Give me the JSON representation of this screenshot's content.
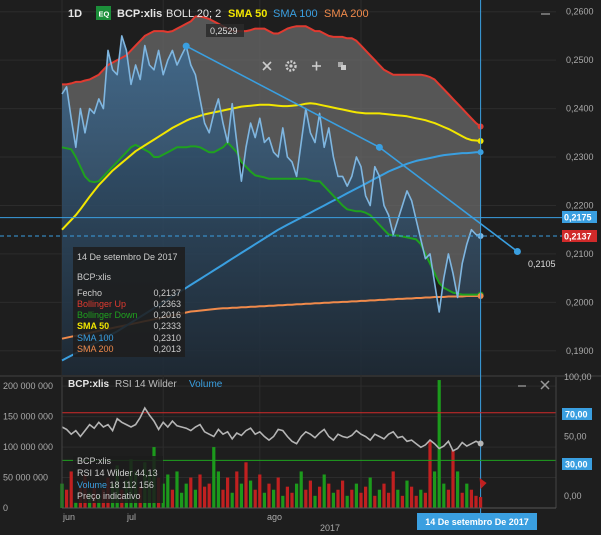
{
  "header": {
    "period": "1D",
    "badge": "EQ",
    "symbol": "BCP:xlis",
    "boll": "BOLL 20; 2",
    "sma50": "SMA 50",
    "sma100": "SMA 100",
    "sma200": "SMA 200"
  },
  "toolbar_icons": [
    "close-icon",
    "gear-icon",
    "plus-icon",
    "layers-icon"
  ],
  "colors": {
    "bg": "#1c1c1c",
    "price": "#7fb6e0",
    "boll_up": "#e03a30",
    "boll_down": "#1fa11f",
    "sma50": "#f2e600",
    "sma100": "#3a9fe0",
    "sma200": "#f08a4b",
    "crosshair": "#3a9fe0",
    "rsi": "#b5b5b5",
    "vol_up": "#1c9a1c",
    "vol_down": "#c02020"
  },
  "price_axis": {
    "ticks": [
      "0,2600",
      "0,2500",
      "0,2400",
      "0,2300",
      "0,2200",
      "0,2100",
      "0,2000",
      "0,1900"
    ],
    "badge_blue": "0,2175",
    "badge_red": "0,2137"
  },
  "annotations": {
    "peak": "0,2529",
    "trend_end": "0,2105"
  },
  "tooltip": {
    "date": "14 De setembro De 2017",
    "name": "BCP:xlis",
    "rows": [
      {
        "label": "Fecho",
        "value": "0,2137",
        "color": "#cccccc"
      },
      {
        "label": "Bollinger Up",
        "value": "0,2363",
        "color": "#e03a30"
      },
      {
        "label": "Bollinger Down",
        "value": "0,2016",
        "color": "#1fa11f"
      },
      {
        "label": "SMA 50",
        "value": "0,2333",
        "color": "#f2e600"
      },
      {
        "label": "SMA 100",
        "value": "0,2310",
        "color": "#3a9fe0"
      },
      {
        "label": "SMA 200",
        "value": "0,2013",
        "color": "#f08a4b"
      }
    ]
  },
  "lower_header": {
    "symbol": "BCP:xlis",
    "rsi": "RSI 14 Wilder",
    "volume": "Volume"
  },
  "lower_tooltip": {
    "name": "BCP:xlis",
    "rsi_label": "RSI 14 Wilder",
    "rsi_value": "44,13",
    "vol_label": "Volume",
    "vol_value": "18 112 156",
    "note": "Preço indicativo"
  },
  "vol_axis": {
    "ticks": [
      "200 000 000",
      "150 000 000",
      "100 000 000",
      "50 000 000",
      "0"
    ]
  },
  "rsi_axis": {
    "ticks": [
      "100,00",
      "70,00",
      "50,00",
      "30,00",
      "0,00"
    ],
    "badges": [
      "70,00",
      "30,00"
    ]
  },
  "x_axis": {
    "months": [
      "jun",
      "jul",
      "ago"
    ],
    "year": "2017",
    "crosshair_date": "14 De setembro De 2017"
  },
  "chart_data": {
    "type": "line",
    "price_range": [
      0.185,
      0.262
    ],
    "days": 92,
    "close": [
      0.243,
      0.2445,
      0.238,
      0.232,
      0.24,
      0.235,
      0.24,
      0.239,
      0.242,
      0.24,
      0.252,
      0.248,
      0.247,
      0.255,
      0.252,
      0.245,
      0.249,
      0.246,
      0.253,
      0.249,
      0.248,
      0.252,
      0.247,
      0.25,
      0.252,
      0.249,
      0.251,
      0.2529,
      0.249,
      0.247,
      0.242,
      0.237,
      0.235,
      0.239,
      0.242,
      0.237,
      0.233,
      0.241,
      0.233,
      0.225,
      0.232,
      0.237,
      0.234,
      0.238,
      0.233,
      0.234,
      0.231,
      0.23,
      0.236,
      0.23,
      0.229,
      0.226,
      0.233,
      0.24,
      0.235,
      0.233,
      0.239,
      0.232,
      0.236,
      0.23,
      0.226,
      0.226,
      0.224,
      0.226,
      0.23,
      0.228,
      0.222,
      0.22,
      0.228,
      0.226,
      0.22,
      0.218,
      0.214,
      0.217,
      0.22,
      0.223,
      0.221,
      0.217,
      0.213,
      0.209,
      0.21,
      0.204,
      0.198,
      0.205,
      0.21,
      0.206,
      0.201,
      0.208,
      0.212,
      0.215,
      0.214,
      0.2137
    ],
    "boll_up": [
      0.245,
      0.245,
      0.2452,
      0.2455,
      0.2455,
      0.2458,
      0.246,
      0.2465,
      0.247,
      0.248,
      0.249,
      0.2495,
      0.25,
      0.2505,
      0.251,
      0.252,
      0.253,
      0.254,
      0.255,
      0.2555,
      0.256,
      0.256,
      0.256,
      0.2558,
      0.256,
      0.2565,
      0.257,
      0.2575,
      0.258,
      0.259,
      0.259,
      0.2588,
      0.2585,
      0.258,
      0.2575,
      0.257,
      0.2565,
      0.256,
      0.256,
      0.256,
      0.256,
      0.2562,
      0.2565,
      0.2565,
      0.2565,
      0.256,
      0.2555,
      0.2555,
      0.256,
      0.2565,
      0.2568,
      0.257,
      0.257,
      0.257,
      0.2565,
      0.256,
      0.256,
      0.2555,
      0.255,
      0.2548,
      0.2548,
      0.2548,
      0.2545,
      0.2545,
      0.254,
      0.253,
      0.252,
      0.251,
      0.25,
      0.249,
      0.248,
      0.2475,
      0.247,
      0.247,
      0.247,
      0.247,
      0.247,
      0.247,
      0.247,
      0.2468,
      0.2465,
      0.246,
      0.245,
      0.244,
      0.243,
      0.242,
      0.241,
      0.24,
      0.239,
      0.238,
      0.237,
      0.2363
    ],
    "boll_down": [
      0.232,
      0.2318,
      0.2316,
      0.23,
      0.228,
      0.226,
      0.225,
      0.2248,
      0.225,
      0.226,
      0.227,
      0.228,
      0.229,
      0.23,
      0.231,
      0.232,
      0.2325,
      0.232,
      0.2315,
      0.231,
      0.23,
      0.23,
      0.2305,
      0.231,
      0.2315,
      0.232,
      0.232,
      0.232,
      0.2322,
      0.2322,
      0.232,
      0.2315,
      0.231,
      0.231,
      0.2315,
      0.232,
      0.233,
      0.232,
      0.231,
      0.229,
      0.228,
      0.227,
      0.2262,
      0.226,
      0.2258,
      0.2255,
      0.2255,
      0.2255,
      0.2255,
      0.2255,
      0.2255,
      0.2255,
      0.2255,
      0.2255,
      0.2252,
      0.225,
      0.225,
      0.224,
      0.223,
      0.222,
      0.221,
      0.22,
      0.2192,
      0.219,
      0.2188,
      0.2188,
      0.2185,
      0.218,
      0.217,
      0.216,
      0.215,
      0.214,
      0.2138,
      0.2138,
      0.2136,
      0.2134,
      0.2132,
      0.213,
      0.212,
      0.21,
      0.208,
      0.206,
      0.204,
      0.203,
      0.2025,
      0.202,
      0.2018,
      0.2016,
      0.2016,
      0.2016,
      0.2016,
      0.2016
    ],
    "sma50": [
      0.215,
      0.216,
      0.217,
      0.218,
      0.2192,
      0.2205,
      0.2218,
      0.223,
      0.2242,
      0.2252,
      0.2262,
      0.2272,
      0.228,
      0.2288,
      0.2296,
      0.2304,
      0.2312,
      0.2318,
      0.2324,
      0.233,
      0.2336,
      0.2342,
      0.2348,
      0.2354,
      0.236,
      0.2365,
      0.237,
      0.2375,
      0.2379,
      0.2382,
      0.2385,
      0.2388,
      0.239,
      0.2392,
      0.2394,
      0.2396,
      0.2398,
      0.24,
      0.2402,
      0.2404,
      0.2405,
      0.2406,
      0.2407,
      0.2408,
      0.2408,
      0.2408,
      0.2407,
      0.2406,
      0.2405,
      0.2405,
      0.2406,
      0.2407,
      0.2408,
      0.241,
      0.2411,
      0.241,
      0.2408,
      0.2406,
      0.2404,
      0.2402,
      0.24,
      0.2398,
      0.2396,
      0.2394,
      0.2392,
      0.2391,
      0.239,
      0.239,
      0.239,
      0.239,
      0.2389,
      0.2388,
      0.2387,
      0.2386,
      0.2385,
      0.2384,
      0.2382,
      0.238,
      0.2378,
      0.2376,
      0.2373,
      0.237,
      0.2366,
      0.2362,
      0.2358,
      0.2353,
      0.2348,
      0.2343,
      0.2338,
      0.2335,
      0.2334,
      0.2333
    ],
    "sma100": [
      0.188,
      0.1885,
      0.189,
      0.1895,
      0.19,
      0.1905,
      0.191,
      0.1915,
      0.192,
      0.1925,
      0.193,
      0.1935,
      0.194,
      0.1946,
      0.1952,
      0.1958,
      0.1964,
      0.197,
      0.1976,
      0.1982,
      0.1988,
      0.1994,
      0.2,
      0.2006,
      0.2012,
      0.2018,
      0.2024,
      0.203,
      0.2036,
      0.2042,
      0.2048,
      0.2054,
      0.206,
      0.2066,
      0.2072,
      0.2078,
      0.2084,
      0.209,
      0.2096,
      0.2102,
      0.2108,
      0.2114,
      0.212,
      0.2126,
      0.2132,
      0.2138,
      0.2144,
      0.215,
      0.2155,
      0.216,
      0.2165,
      0.217,
      0.2175,
      0.218,
      0.2185,
      0.219,
      0.2195,
      0.22,
      0.2205,
      0.221,
      0.2215,
      0.222,
      0.2225,
      0.223,
      0.2235,
      0.224,
      0.2245,
      0.225,
      0.2255,
      0.226,
      0.2265,
      0.227,
      0.2274,
      0.2278,
      0.2282,
      0.2286,
      0.2289,
      0.2292,
      0.2294,
      0.2296,
      0.2298,
      0.23,
      0.2302,
      0.2304,
      0.2305,
      0.2306,
      0.2307,
      0.2308,
      0.2308,
      0.2309,
      0.231,
      0.231
    ],
    "sma200": [
      0.1925,
      0.1927,
      0.1929,
      0.1931,
      0.1933,
      0.1935,
      0.1937,
      0.1939,
      0.1941,
      0.1943,
      0.1945,
      0.1947,
      0.1949,
      0.1951,
      0.1953,
      0.1955,
      0.1957,
      0.1959,
      0.1961,
      0.1963,
      0.1965,
      0.1967,
      0.1969,
      0.1971,
      0.1973,
      0.1975,
      0.1977,
      0.1979,
      0.1981,
      0.1982,
      0.1983,
      0.1984,
      0.1985,
      0.1986,
      0.1987,
      0.1988,
      0.1988,
      0.1989,
      0.1989,
      0.199,
      0.199,
      0.1991,
      0.1991,
      0.1992,
      0.1992,
      0.1993,
      0.1993,
      0.1994,
      0.1994,
      0.1995,
      0.1995,
      0.1996,
      0.1996,
      0.1997,
      0.1997,
      0.1998,
      0.1998,
      0.1999,
      0.1999,
      0.2,
      0.2,
      0.2001,
      0.2001,
      0.2002,
      0.2002,
      0.2003,
      0.2003,
      0.2004,
      0.2004,
      0.2005,
      0.2005,
      0.2006,
      0.2006,
      0.2007,
      0.2007,
      0.2008,
      0.2008,
      0.2009,
      0.2009,
      0.201,
      0.201,
      0.2011,
      0.2011,
      0.2011,
      0.2012,
      0.2012,
      0.2012,
      0.2012,
      0.2013,
      0.2013,
      0.2013,
      0.2013
    ],
    "trendline": [
      [
        27,
        0.2529
      ],
      [
        69,
        0.232
      ],
      [
        99,
        0.2105
      ]
    ],
    "hline_solid": 0.2175,
    "hline_dashed": 0.2137,
    "rsi": [
      58,
      56,
      52,
      55,
      50,
      55,
      60,
      57,
      62,
      58,
      60,
      55,
      65,
      62,
      60,
      58,
      60,
      66,
      74,
      68,
      63,
      56,
      62,
      58,
      63,
      59,
      58,
      57,
      55,
      58,
      60,
      54,
      52,
      50,
      56,
      52,
      54,
      48,
      53,
      51,
      55,
      57,
      52,
      54,
      50,
      47,
      50,
      56,
      55,
      50,
      46,
      44,
      50,
      54,
      52,
      49,
      53,
      56,
      50,
      47,
      52,
      50,
      49,
      51,
      55,
      52,
      50,
      47,
      52,
      50,
      48,
      52,
      54,
      49,
      50,
      46,
      47,
      44,
      41,
      43,
      47,
      44,
      40,
      42,
      46,
      38,
      40,
      45,
      42,
      44,
      46,
      44.13
    ],
    "volume": [
      [
        40,
        1
      ],
      [
        30,
        -1
      ],
      [
        60,
        -1
      ],
      [
        10,
        1
      ],
      [
        35,
        -1
      ],
      [
        55,
        -1
      ],
      [
        25,
        1
      ],
      [
        40,
        -1
      ],
      [
        20,
        1
      ],
      [
        30,
        -1
      ],
      [
        50,
        -1
      ],
      [
        40,
        1
      ],
      [
        70,
        1
      ],
      [
        30,
        -1
      ],
      [
        45,
        1
      ],
      [
        80,
        1
      ],
      [
        60,
        1
      ],
      [
        35,
        -1
      ],
      [
        75,
        1
      ],
      [
        60,
        1
      ],
      [
        100,
        1
      ],
      [
        50,
        -1
      ],
      [
        40,
        1
      ],
      [
        55,
        1
      ],
      [
        30,
        -1
      ],
      [
        60,
        1
      ],
      [
        25,
        1
      ],
      [
        40,
        1
      ],
      [
        50,
        -1
      ],
      [
        30,
        1
      ],
      [
        55,
        -1
      ],
      [
        35,
        -1
      ],
      [
        40,
        -1
      ],
      [
        100,
        1
      ],
      [
        60,
        1
      ],
      [
        30,
        -1
      ],
      [
        50,
        -1
      ],
      [
        25,
        1
      ],
      [
        60,
        -1
      ],
      [
        40,
        1
      ],
      [
        75,
        -1
      ],
      [
        45,
        1
      ],
      [
        30,
        -1
      ],
      [
        55,
        -1
      ],
      [
        25,
        1
      ],
      [
        40,
        -1
      ],
      [
        30,
        1
      ],
      [
        50,
        -1
      ],
      [
        20,
        1
      ],
      [
        35,
        -1
      ],
      [
        25,
        -1
      ],
      [
        40,
        1
      ],
      [
        60,
        1
      ],
      [
        30,
        -1
      ],
      [
        45,
        -1
      ],
      [
        20,
        1
      ],
      [
        35,
        -1
      ],
      [
        55,
        1
      ],
      [
        40,
        -1
      ],
      [
        25,
        1
      ],
      [
        30,
        -1
      ],
      [
        45,
        -1
      ],
      [
        20,
        1
      ],
      [
        30,
        -1
      ],
      [
        40,
        1
      ],
      [
        25,
        -1
      ],
      [
        35,
        -1
      ],
      [
        50,
        1
      ],
      [
        20,
        -1
      ],
      [
        30,
        1
      ],
      [
        40,
        -1
      ],
      [
        25,
        -1
      ],
      [
        60,
        -1
      ],
      [
        30,
        1
      ],
      [
        20,
        -1
      ],
      [
        45,
        1
      ],
      [
        35,
        -1
      ],
      [
        20,
        -1
      ],
      [
        30,
        1
      ],
      [
        25,
        -1
      ],
      [
        110,
        -1
      ],
      [
        60,
        1
      ],
      [
        210,
        1
      ],
      [
        40,
        1
      ],
      [
        30,
        -1
      ],
      [
        95,
        -1
      ],
      [
        60,
        1
      ],
      [
        25,
        -1
      ],
      [
        40,
        1
      ],
      [
        30,
        -1
      ],
      [
        20,
        -1
      ],
      [
        18,
        -1
      ]
    ],
    "vol_range": [
      0,
      215
    ],
    "rsi_range": [
      -10,
      100
    ],
    "rsi_levels": [
      70,
      30
    ],
    "month_starts": {
      "jun": 0,
      "jul": 22,
      "ago": 43
    }
  }
}
